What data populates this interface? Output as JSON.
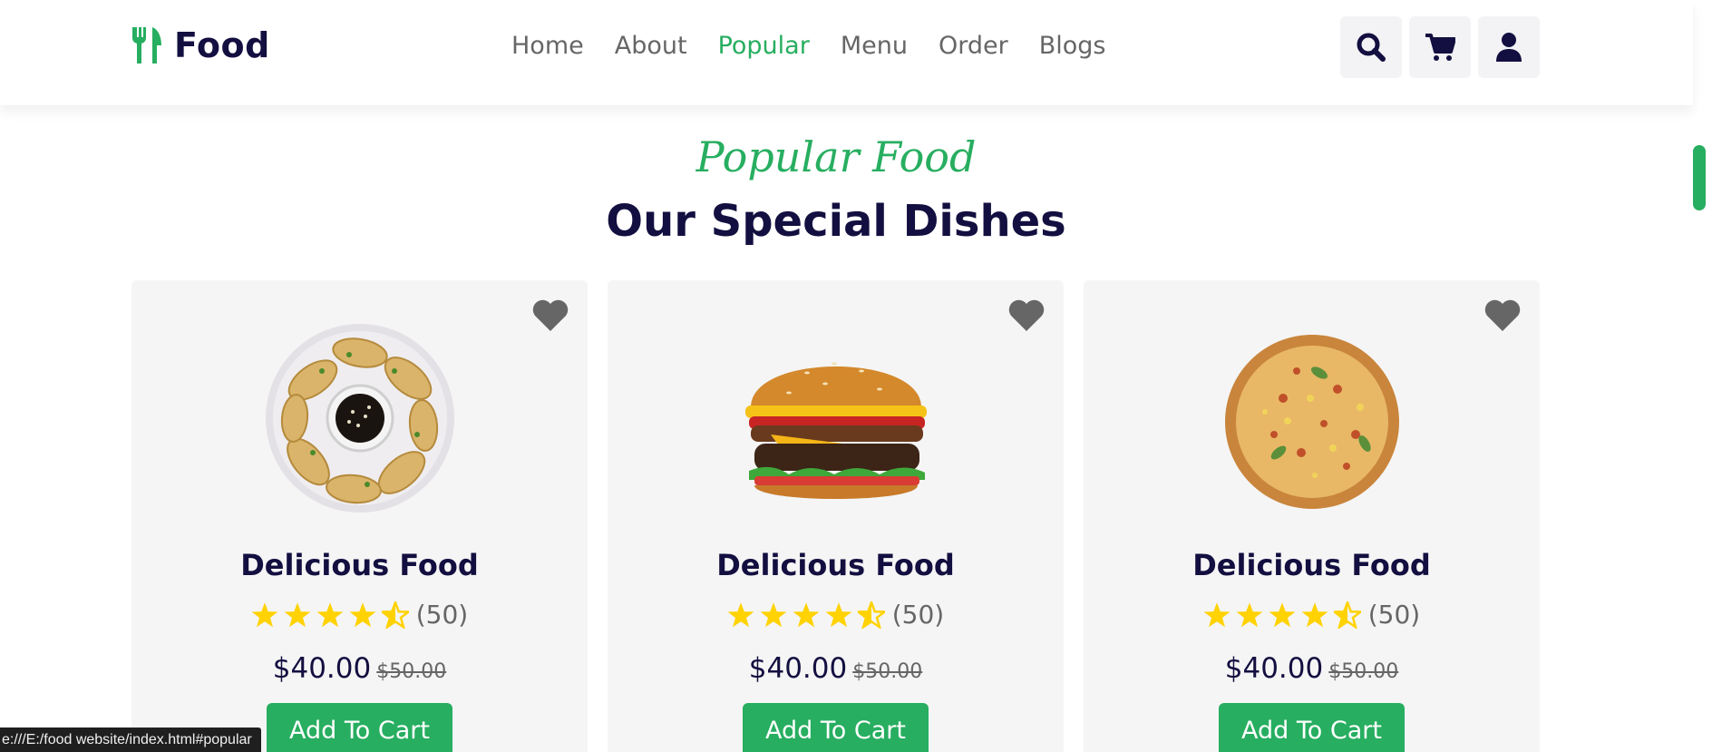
{
  "brand": {
    "name": "Food"
  },
  "nav": [
    {
      "label": "Home",
      "active": false
    },
    {
      "label": "About",
      "active": false
    },
    {
      "label": "Popular",
      "active": true
    },
    {
      "label": "Menu",
      "active": false
    },
    {
      "label": "Order",
      "active": false
    },
    {
      "label": "Blogs",
      "active": false
    }
  ],
  "header_icons": [
    "search-icon",
    "cart-icon",
    "user-icon"
  ],
  "section": {
    "sub_heading": "Popular Food",
    "heading": "Our Special Dishes"
  },
  "cards": [
    {
      "image": "dumplings",
      "name": "Delicious Food",
      "rating": 4.5,
      "rating_count": "(50)",
      "price": "$40.00",
      "old_price": "$50.00",
      "button": "Add To Cart"
    },
    {
      "image": "burger",
      "name": "Delicious Food",
      "rating": 4.5,
      "rating_count": "(50)",
      "price": "$40.00",
      "old_price": "$50.00",
      "button": "Add To Cart"
    },
    {
      "image": "pizza",
      "name": "Delicious Food",
      "rating": 4.5,
      "rating_count": "(50)",
      "price": "$40.00",
      "old_price": "$50.00",
      "button": "Add To Cart"
    }
  ],
  "status_bar": {
    "url": "e:///E:/food website/index.html#popular"
  },
  "colors": {
    "accent": "#27ae60",
    "dark": "#130f40",
    "light_bg": "#f5f5f5",
    "star": "#ffd200"
  }
}
